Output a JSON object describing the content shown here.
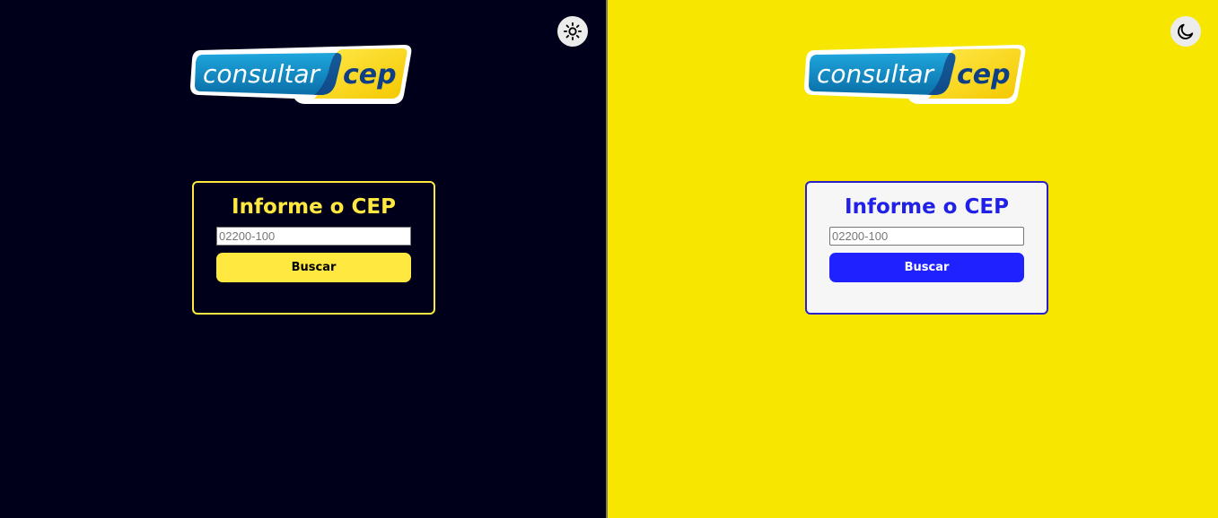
{
  "dark_panel": {
    "theme_toggle_icon": "sun-icon",
    "logo": {
      "text_left": "consultar",
      "text_right": "cep"
    },
    "form": {
      "title": "Informe o CEP",
      "input_placeholder": "02200-100",
      "input_value": "",
      "button_label": "Buscar"
    },
    "colors": {
      "background": "#00001a",
      "accent": "#ffe940"
    }
  },
  "light_panel": {
    "theme_toggle_icon": "moon-icon",
    "logo": {
      "text_left": "consultar",
      "text_right": "cep"
    },
    "form": {
      "title": "Informe o CEP",
      "input_placeholder": "02200-100",
      "input_value": "",
      "button_label": "Buscar"
    },
    "colors": {
      "background": "#f7e600",
      "accent": "#1f22ff"
    }
  }
}
